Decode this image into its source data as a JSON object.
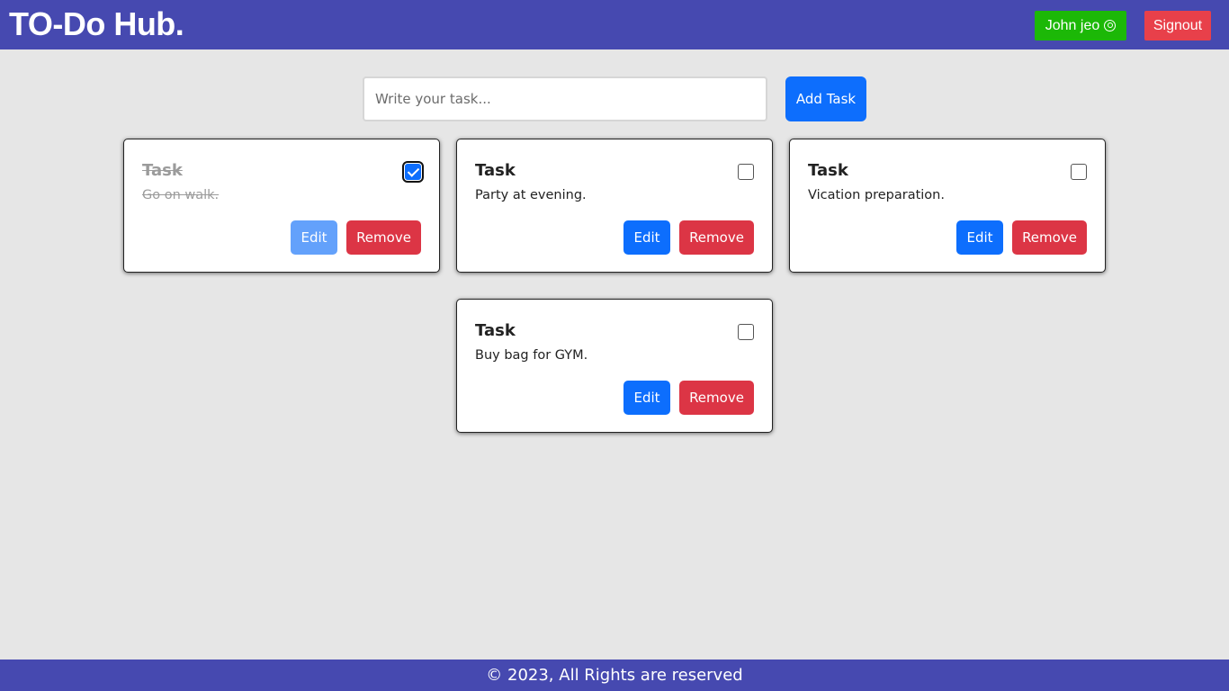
{
  "header": {
    "brand": "TO-Do Hub.",
    "user_label": "John jeo",
    "user_icon": "user-circle-icon",
    "signout_label": "Signout"
  },
  "composer": {
    "placeholder": "Write your task...",
    "value": "",
    "add_label": "Add Task"
  },
  "tasks": [
    {
      "title": "Task",
      "description": "Go on walk.",
      "completed": true,
      "edit_label": "Edit",
      "remove_label": "Remove"
    },
    {
      "title": "Task",
      "description": "Party at evening.",
      "completed": false,
      "edit_label": "Edit",
      "remove_label": "Remove"
    },
    {
      "title": "Task",
      "description": "Vication preparation.",
      "completed": false,
      "edit_label": "Edit",
      "remove_label": "Remove"
    },
    {
      "title": "Task",
      "description": "Buy bag for GYM.",
      "completed": false,
      "edit_label": "Edit",
      "remove_label": "Remove"
    }
  ],
  "footer": {
    "text": "© 2023, All Rights are reserved"
  },
  "colors": {
    "navbar": "#4649b0",
    "background": "#e6e6e6",
    "user_button": "#1cb807",
    "signout_button": "#e8404a",
    "primary": "#0d6efd",
    "danger": "#dc3545"
  }
}
